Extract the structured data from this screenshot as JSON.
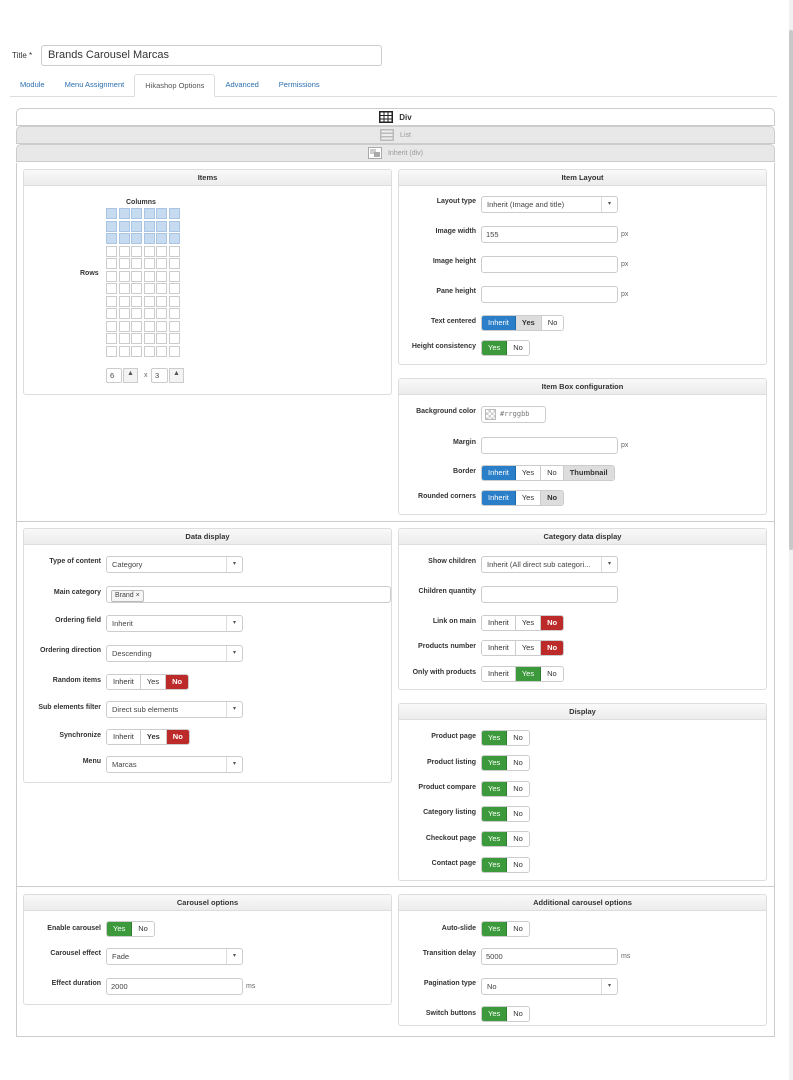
{
  "title": {
    "label": "Title *",
    "value": "Brands Carousel Marcas"
  },
  "tabs": [
    {
      "label": "Module"
    },
    {
      "label": "Menu Assignment"
    },
    {
      "label": "Hikashop Options"
    },
    {
      "label": "Advanced"
    },
    {
      "label": "Permissions"
    }
  ],
  "modes": [
    {
      "label": "Div",
      "icon": "grid-layout-icon"
    },
    {
      "label": "List",
      "icon": "list-layout-icon"
    },
    {
      "label": "Inherit (div)",
      "icon": "inherit-layout-icon"
    }
  ],
  "items_panel": {
    "header": "Items",
    "columns_label": "Columns",
    "rows_label": "Rows",
    "columns": "6",
    "rows": "3",
    "times": "x",
    "up": "▲",
    "down": "▲"
  },
  "item_layout": {
    "header": "Item Layout",
    "layout_type": {
      "label": "Layout type",
      "value": "Inherit (Image and title)"
    },
    "image_width": {
      "label": "Image width",
      "value": "155",
      "unit": "px"
    },
    "image_height": {
      "label": "Image height",
      "value": "",
      "unit": "px"
    },
    "pane_height": {
      "label": "Pane height",
      "value": "",
      "unit": "px"
    },
    "text_centered": {
      "label": "Text centered",
      "options": [
        "Inherit",
        "Yes",
        "No"
      ]
    },
    "height_consistency": {
      "label": "Height consistency",
      "options": [
        "Yes",
        "No"
      ]
    }
  },
  "item_box": {
    "header": "Item Box configuration",
    "background_color": {
      "label": "Background color",
      "placeholder": "#rrggbb"
    },
    "margin": {
      "label": "Margin",
      "value": "",
      "unit": "px"
    },
    "border": {
      "label": "Border",
      "options": [
        "Inherit",
        "Yes",
        "No",
        "Thumbnail"
      ]
    },
    "rounded_corners": {
      "label": "Rounded corners",
      "options": [
        "Inherit",
        "Yes",
        "No"
      ]
    }
  },
  "data_display": {
    "header": "Data display",
    "type_of_content": {
      "label": "Type of content",
      "value": "Category"
    },
    "main_category": {
      "label": "Main category",
      "tag": "Brand",
      "remove": "×"
    },
    "ordering_field": {
      "label": "Ordering field",
      "value": "Inherit"
    },
    "ordering_direction": {
      "label": "Ordering direction",
      "value": "Descending"
    },
    "random_items": {
      "label": "Random items",
      "options": [
        "Inherit",
        "Yes",
        "No"
      ]
    },
    "sub_elements_filter": {
      "label": "Sub elements filter",
      "value": "Direct sub elements"
    },
    "synchronize": {
      "label": "Synchronize",
      "options": [
        "Inherit",
        "Yes",
        "No"
      ]
    },
    "menu": {
      "label": "Menu",
      "value": "Marcas"
    }
  },
  "category_display": {
    "header": "Category data display",
    "show_children": {
      "label": "Show children",
      "value": "Inherit (All direct sub categori..."
    },
    "children_quantity": {
      "label": "Children quantity",
      "value": ""
    },
    "link_on_main": {
      "label": "Link on main",
      "options": [
        "Inherit",
        "Yes",
        "No"
      ]
    },
    "products_number": {
      "label": "Products number",
      "options": [
        "Inherit",
        "Yes",
        "No"
      ]
    },
    "only_with_products": {
      "label": "Only with products",
      "options": [
        "Inherit",
        "Yes",
        "No"
      ]
    }
  },
  "display": {
    "header": "Display",
    "rows": [
      {
        "label": "Product page",
        "options": [
          "Yes",
          "No"
        ]
      },
      {
        "label": "Product listing",
        "options": [
          "Yes",
          "No"
        ]
      },
      {
        "label": "Product compare",
        "options": [
          "Yes",
          "No"
        ]
      },
      {
        "label": "Category listing",
        "options": [
          "Yes",
          "No"
        ]
      },
      {
        "label": "Checkout page",
        "options": [
          "Yes",
          "No"
        ]
      },
      {
        "label": "Contact page",
        "options": [
          "Yes",
          "No"
        ]
      }
    ]
  },
  "carousel": {
    "header": "Carousel options",
    "enable_carousel": {
      "label": "Enable carousel",
      "options": [
        "Yes",
        "No"
      ]
    },
    "carousel_effect": {
      "label": "Carousel effect",
      "value": "Fade"
    },
    "effect_duration": {
      "label": "Effect duration",
      "value": "2000",
      "unit": "ms"
    }
  },
  "additional_carousel": {
    "header": "Additional carousel options",
    "auto_slide": {
      "label": "Auto-slide",
      "options": [
        "Yes",
        "No"
      ]
    },
    "transition_delay": {
      "label": "Transition delay",
      "value": "5000",
      "unit": "ms"
    },
    "pagination_type": {
      "label": "Pagination type",
      "value": "No"
    },
    "switch_buttons": {
      "label": "Switch buttons",
      "options": [
        "Yes",
        "No"
      ]
    }
  },
  "colors": {
    "green": "#3c9a3c",
    "red": "#bd2a2a",
    "blue": "#2a7fc8",
    "link": "#2a6eae"
  },
  "arrow": "▾"
}
